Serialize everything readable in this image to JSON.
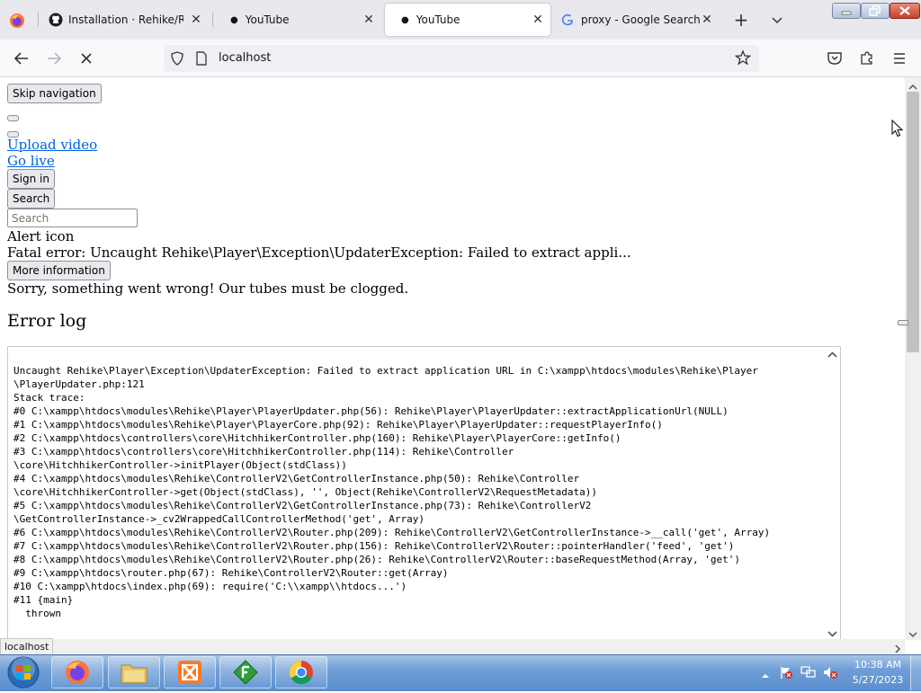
{
  "browser": {
    "tabs": [
      {
        "title": "Installation · Rehike/Rehike",
        "active": false,
        "icon": "github-icon"
      },
      {
        "title": "YouTube",
        "active": false,
        "icon": "dot-icon"
      },
      {
        "title": "YouTube",
        "active": true,
        "icon": "dot-icon"
      },
      {
        "title": "proxy - Google Search",
        "active": false,
        "icon": "google-icon"
      }
    ],
    "url": "localhost",
    "status_url": "localhost"
  },
  "page": {
    "skip_navigation": "Skip navigation",
    "upload_video": "Upload video",
    "go_live": "Go live",
    "sign_in": "Sign in",
    "search_button": "Search",
    "search_placeholder": "Search",
    "alert_icon_text": "Alert icon",
    "fatal_error": "Fatal error: Uncaught Rehike\\Player\\Exception\\UpdaterException: Failed to extract appli...",
    "more_information": "More information",
    "sorry_message": "Sorry, something went wrong! Our tubes must be clogged.",
    "error_log_heading": "Error log",
    "error_log": "Uncaught Rehike\\Player\\Exception\\UpdaterException: Failed to extract application URL in C:\\xampp\\htdocs\\modules\\Rehike\\Player\n\\PlayerUpdater.php:121\nStack trace:\n#0 C:\\xampp\\htdocs\\modules\\Rehike\\Player\\PlayerUpdater.php(56): Rehike\\Player\\PlayerUpdater::extractApplicationUrl(NULL)\n#1 C:\\xampp\\htdocs\\modules\\Rehike\\Player\\PlayerCore.php(92): Rehike\\Player\\PlayerUpdater::requestPlayerInfo()\n#2 C:\\xampp\\htdocs\\controllers\\core\\HitchhikerController.php(160): Rehike\\Player\\PlayerCore::getInfo()\n#3 C:\\xampp\\htdocs\\controllers\\core\\HitchhikerController.php(114): Rehike\\Controller\n\\core\\HitchhikerController->initPlayer(Object(stdClass))\n#4 C:\\xampp\\htdocs\\modules\\Rehike\\ControllerV2\\GetControllerInstance.php(50): Rehike\\Controller\n\\core\\HitchhikerController->get(Object(stdClass), '', Object(Rehike\\ControllerV2\\RequestMetadata))\n#5 C:\\xampp\\htdocs\\modules\\Rehike\\ControllerV2\\GetControllerInstance.php(73): Rehike\\ControllerV2\n\\GetControllerInstance->_cv2WrappedCallControllerMethod('get', Array)\n#6 C:\\xampp\\htdocs\\modules\\Rehike\\ControllerV2\\Router.php(209): Rehike\\ControllerV2\\GetControllerInstance->__call('get', Array)\n#7 C:\\xampp\\htdocs\\modules\\Rehike\\ControllerV2\\Router.php(156): Rehike\\ControllerV2\\Router::pointerHandler('feed', 'get')\n#8 C:\\xampp\\htdocs\\modules\\Rehike\\ControllerV2\\Router.php(26): Rehike\\ControllerV2\\Router::baseRequestMethod(Array, 'get')\n#9 C:\\xampp\\htdocs\\router.php(67): Rehike\\ControllerV2\\Router::get(Array)\n#10 C:\\xampp\\htdocs\\index.php(69): require('C:\\\\xampp\\\\htdocs...')\n#11 {main}\n  thrown"
  },
  "taskbar": {
    "apps": [
      "start-orb",
      "firefox-icon",
      "file-explorer-icon",
      "xampp-icon",
      "filezilla-icon",
      "chrome-icon"
    ],
    "clock_time": "10:38 AM",
    "clock_date": "5/27/2023"
  },
  "colors": {
    "link": "#0060df",
    "tabstrip": "#e8e8ed",
    "taskbar": "#6f9ed6"
  }
}
